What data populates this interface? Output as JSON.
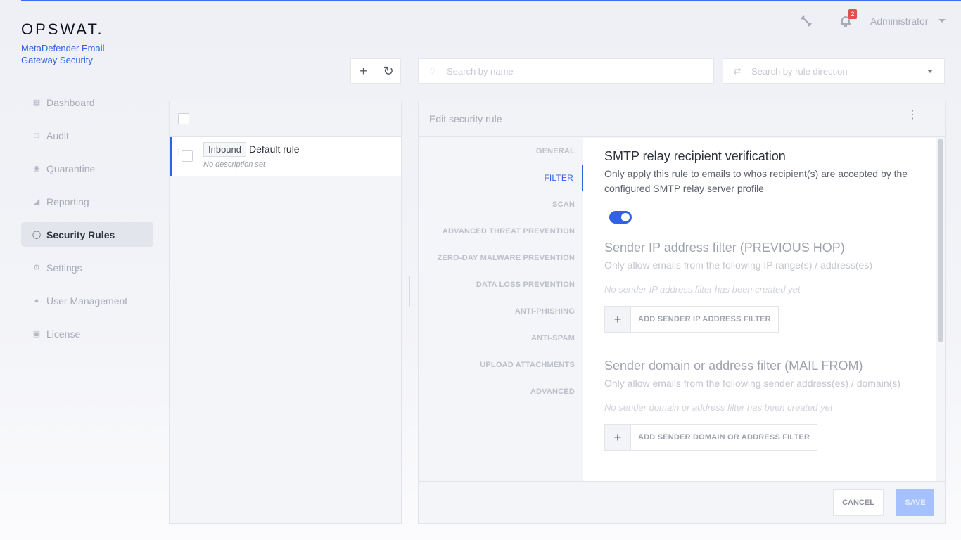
{
  "app": {
    "logo_word": "OPSWAT.",
    "product_line1": "MetaDefender Email",
    "product_line2": "Gateway Security",
    "accent_color": "#2f62e6"
  },
  "header": {
    "notification_count": "2",
    "user_name": "Administrator",
    "icons": [
      "unlink-icon",
      "bell-icon",
      "chevron-down-icon"
    ]
  },
  "sidebar": {
    "items": [
      {
        "label": "Dashboard",
        "icon": "dashboard-icon"
      },
      {
        "label": "Audit",
        "icon": "audit-icon"
      },
      {
        "label": "Quarantine",
        "icon": "quarantine-icon"
      },
      {
        "label": "Reporting",
        "icon": "chart-icon"
      },
      {
        "label": "Security Rules",
        "icon": "shield-icon",
        "active": true
      },
      {
        "label": "Settings",
        "icon": "gear-icon"
      },
      {
        "label": "User Management",
        "icon": "users-icon"
      },
      {
        "label": "License",
        "icon": "license-icon"
      }
    ]
  },
  "toolbar": {
    "search_name_placeholder": "Search by name",
    "search_direction_placeholder": "Search by rule direction"
  },
  "rules": {
    "items": [
      {
        "direction": "Inbound",
        "name": "Default rule",
        "description": "No description set"
      }
    ]
  },
  "edit": {
    "title": "Edit security rule",
    "tabs": [
      "GENERAL",
      "FILTER",
      "SCAN",
      "ADVANCED THREAT PREVENTION",
      "ZERO-DAY MALWARE PREVENTION",
      "DATA LOSS PREVENTION",
      "ANTI-PHISHING",
      "ANTI-SPAM",
      "UPLOAD ATTACHMENTS",
      "ADVANCED"
    ],
    "active_tab": "FILTER",
    "sections": {
      "smtp": {
        "title": "SMTP relay recipient verification",
        "description": "Only apply this rule to emails to whos recipient(s) are accepted by the configured SMTP relay server profile",
        "enabled": true
      },
      "sender_ip": {
        "title": "Sender IP address filter (PREVIOUS HOP)",
        "description": "Only allow emails from the following IP range(s) / address(es)",
        "empty": "No sender IP address filter has been created yet",
        "button": "ADD SENDER IP ADDRESS FILTER"
      },
      "sender_domain": {
        "title": "Sender domain or address filter (MAIL FROM)",
        "description": "Only allow emails from the following sender address(es) / domain(s)",
        "empty": "No sender domain or address filter has been created yet",
        "button": "ADD SENDER DOMAIN OR ADDRESS FILTER"
      }
    },
    "cancel_label": "CANCEL",
    "save_label": "SAVE"
  }
}
